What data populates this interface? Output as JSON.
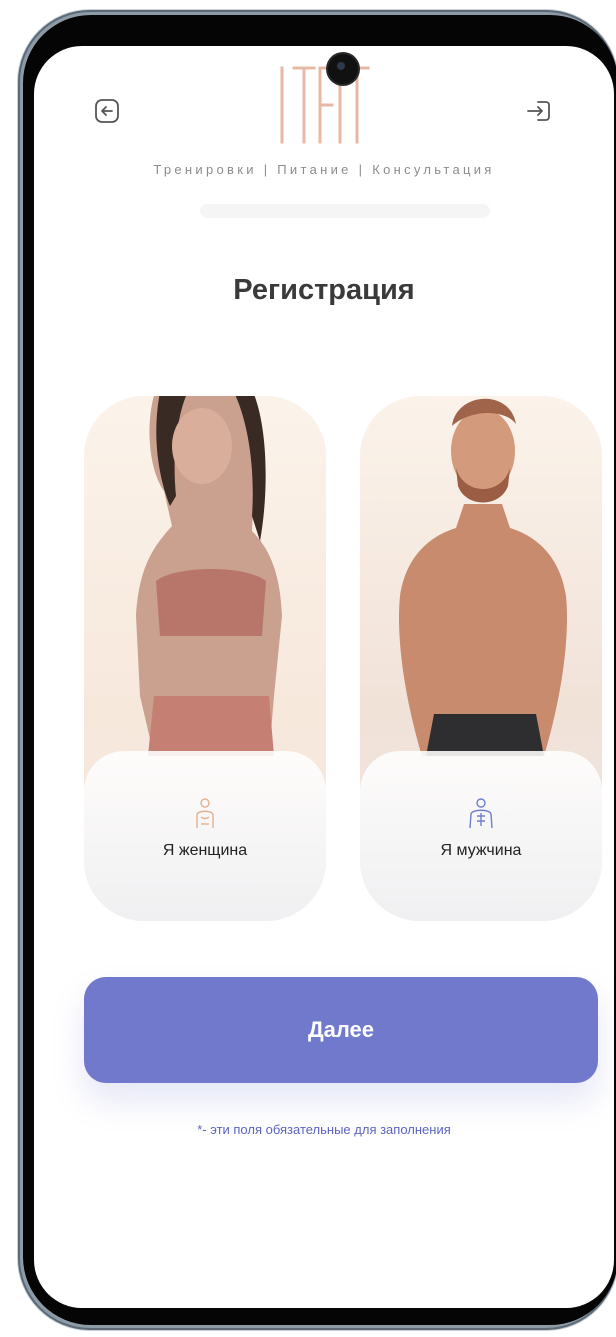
{
  "header": {
    "back_icon": "back-arrow-icon",
    "login_icon": "login-icon",
    "logo_text": "ITFIT",
    "tagline": "Тренировки | Питание | Консультация"
  },
  "title": "Регистрация",
  "gender_options": [
    {
      "label": "Я женщина",
      "icon": "female-figure-icon"
    },
    {
      "label": "Я мужчина",
      "icon": "male-figure-icon"
    }
  ],
  "next_button": "Далее",
  "required_note": "*- эти поля обязательные для заполнения",
  "colors": {
    "accent": "#7179cc",
    "logo": "#e9b8a5",
    "female_icon": "#e3b191",
    "male_icon": "#6f7ecf",
    "note": "#5a64c2"
  }
}
